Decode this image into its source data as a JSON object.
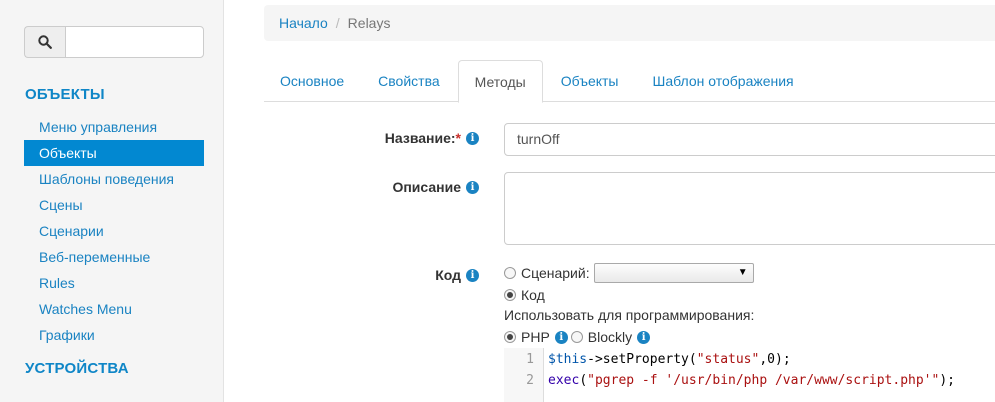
{
  "sidebar": {
    "search_placeholder": "",
    "section1": "ОБЪЕКТЫ",
    "items": [
      {
        "label": "Меню управления",
        "active": false
      },
      {
        "label": "Объекты",
        "active": true
      },
      {
        "label": "Шаблоны поведения",
        "active": false
      },
      {
        "label": "Сцены",
        "active": false
      },
      {
        "label": "Сценарии",
        "active": false
      },
      {
        "label": "Веб-переменные",
        "active": false
      },
      {
        "label": "Rules",
        "active": false
      },
      {
        "label": "Watches Menu",
        "active": false
      },
      {
        "label": "Графики",
        "active": false
      }
    ],
    "section2": "УСТРОЙСТВА"
  },
  "breadcrumb": {
    "home": "Начало",
    "separator": "/",
    "current": "Relays"
  },
  "tabs": [
    {
      "label": "Основное",
      "active": false
    },
    {
      "label": "Свойства",
      "active": false
    },
    {
      "label": "Методы",
      "active": true
    },
    {
      "label": "Объекты",
      "active": false
    },
    {
      "label": "Шаблон отображения",
      "active": false
    }
  ],
  "form": {
    "name_label": "Название:",
    "required_mark": "*",
    "name_value": "turnOff",
    "description_label": "Описание",
    "code_label": "Код",
    "radio_script_label": "Сценарий:",
    "radio_code_label": "Код",
    "use_for_programming": "Использовать для программирования:",
    "php_label": "PHP",
    "blockly_label": "Blockly",
    "info_glyph": "i"
  },
  "editor": {
    "line_numbers": [
      "1",
      "2"
    ]
  },
  "colors": {
    "accent": "#0288d1",
    "link": "#1a83c2",
    "sidebar_bg": "#f5f5f5"
  }
}
